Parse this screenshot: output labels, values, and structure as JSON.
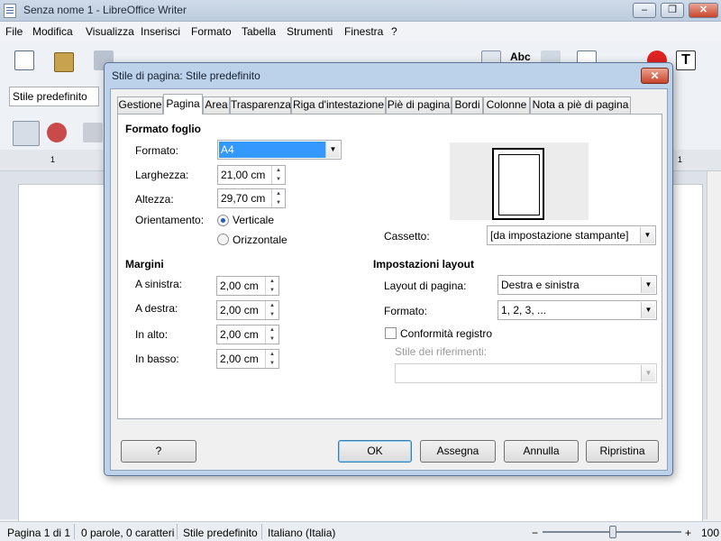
{
  "window": {
    "title": "Senza nome 1 - LibreOffice Writer",
    "controls": [
      "–",
      "❐",
      "✕"
    ]
  },
  "menu": [
    "File",
    "Modifica",
    "Visualizza",
    "Inserisci",
    "Formato",
    "Tabella",
    "Strumenti",
    "Finestra",
    "?"
  ],
  "toolbar": {
    "style_value": "Stile predefinito",
    "spelling_label": "Abc"
  },
  "ruler": {
    "marks": [
      "1",
      "1"
    ]
  },
  "status": {
    "page": "Pagina 1 di 1",
    "words": "0 parole, 0 caratteri",
    "style": "Stile predefinito",
    "language": "Italiano (Italia)",
    "zoom": "100",
    "minus": "−",
    "plus": "+"
  },
  "dialog": {
    "title": "Stile di pagina: Stile predefinito",
    "close": "✕",
    "tabs": [
      "Gestione",
      "Pagina",
      "Area",
      "Trasparenza",
      "Riga d'intestazione",
      "Piè di pagina",
      "Bordi",
      "Colonne",
      "Nota a piè di pagina"
    ],
    "active_tab": "Pagina",
    "paper": {
      "header": "Formato foglio",
      "format_label": "Formato:",
      "format_value": "A4",
      "width_label": "Larghezza:",
      "width_value": "21,00 cm",
      "height_label": "Altezza:",
      "height_value": "29,70 cm",
      "orientation_label": "Orientamento:",
      "portrait": "Verticale",
      "landscape": "Orizzontale",
      "orientation_selected": "Verticale",
      "tray_label": "Cassetto:",
      "tray_value": "[da impostazione stampante]"
    },
    "margins": {
      "header": "Margini",
      "left_label": "A sinistra:",
      "left_value": "2,00 cm",
      "right_label": "A destra:",
      "right_value": "2,00 cm",
      "top_label": "In alto:",
      "top_value": "2,00 cm",
      "bottom_label": "In basso:",
      "bottom_value": "2,00 cm"
    },
    "layout": {
      "header": "Impostazioni layout",
      "page_layout_label": "Layout di pagina:",
      "page_layout_value": "Destra e sinistra",
      "format_label": "Formato:",
      "format_value": "1, 2, 3, ...",
      "register_label": "Conformità registro",
      "register_checked": false,
      "ref_style_label": "Stile dei riferimenti:",
      "ref_style_value": ""
    },
    "buttons": {
      "help": "?",
      "ok": "OK",
      "apply": "Assegna",
      "cancel": "Annulla",
      "reset": "Ripristina"
    }
  }
}
